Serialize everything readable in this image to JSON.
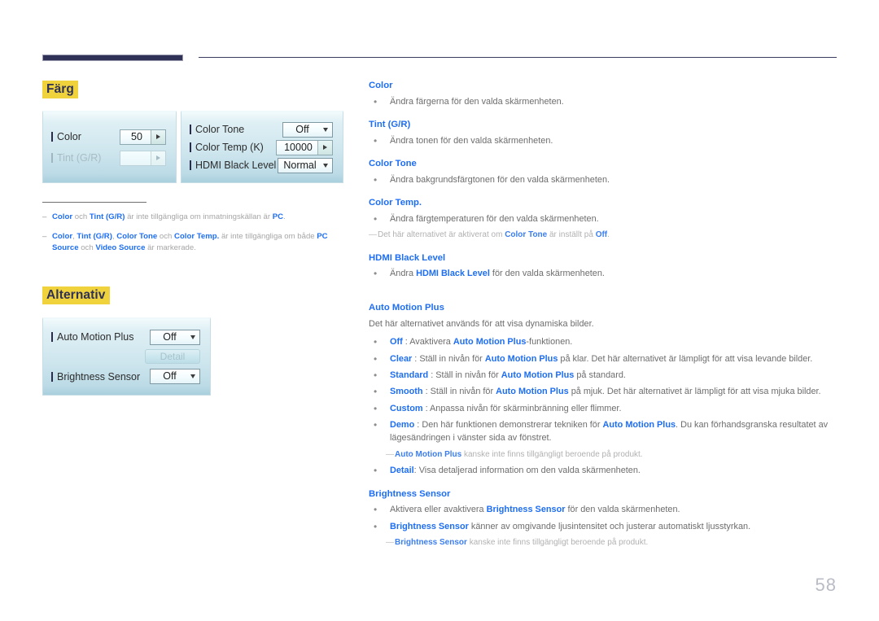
{
  "page": {
    "number": "58"
  },
  "sections": {
    "color": {
      "heading": "Färg",
      "osd": {
        "left_rows": [
          {
            "label": "Color",
            "value": "50",
            "control": "spinner",
            "disabled": false
          },
          {
            "label": "Tint (G/R)",
            "value": "",
            "control": "spinner",
            "disabled": true
          }
        ],
        "right_rows": [
          {
            "label": "Color Tone",
            "value": "Off",
            "control": "dropdown",
            "disabled": false
          },
          {
            "label": "Color Temp (K)",
            "value": "10000",
            "control": "spinner",
            "disabled": false
          },
          {
            "label": "HDMI Black Level",
            "value": "Normal",
            "control": "dropdown",
            "disabled": false
          }
        ]
      },
      "notes": [
        {
          "dash": "‒",
          "parts": [
            {
              "t": "Color",
              "b": true
            },
            {
              "t": " och ",
              "b": false
            },
            {
              "t": "Tint (G/R)",
              "b": true
            },
            {
              "t": " är inte tillgängliga om inmatningskällan är ",
              "b": false
            },
            {
              "t": "PC",
              "b": true
            },
            {
              "t": ".",
              "b": false
            }
          ]
        },
        {
          "dash": "‒",
          "parts": [
            {
              "t": "Color",
              "b": true
            },
            {
              "t": ", ",
              "b": false
            },
            {
              "t": "Tint (G/R)",
              "b": true
            },
            {
              "t": ", ",
              "b": false
            },
            {
              "t": "Color Tone",
              "b": true
            },
            {
              "t": " och ",
              "b": false
            },
            {
              "t": "Color Temp.",
              "b": true
            },
            {
              "t": " är inte tillgängliga om både ",
              "b": false
            },
            {
              "t": "PC Source",
              "b": true
            },
            {
              "t": " och ",
              "b": false
            },
            {
              "t": "Video Source",
              "b": true
            },
            {
              "t": " är markerade.",
              "b": false
            }
          ]
        }
      ]
    },
    "options": {
      "heading": "Alternativ",
      "osd": {
        "rows": [
          {
            "label": "Auto Motion Plus",
            "value": "Off",
            "control": "dropdown",
            "disabled": false
          },
          {
            "label": "Detail",
            "control": "button",
            "disabled": true
          },
          {
            "label": "Brightness Sensor",
            "value": "Off",
            "control": "dropdown",
            "disabled": false
          }
        ]
      }
    }
  },
  "descriptions": [
    {
      "type": "head",
      "text": "Color"
    },
    {
      "type": "bullet",
      "bullet": "•",
      "parts": [
        {
          "t": "Ändra färgerna för den valda skärmenheten.",
          "b": false
        }
      ]
    },
    {
      "type": "head",
      "text": "Tint (G/R)"
    },
    {
      "type": "bullet",
      "bullet": "•",
      "parts": [
        {
          "t": "Ändra tonen för den valda skärmenheten.",
          "b": false
        }
      ]
    },
    {
      "type": "head",
      "text": "Color Tone"
    },
    {
      "type": "bullet",
      "bullet": "•",
      "parts": [
        {
          "t": "Ändra bakgrundsfärgtonen för den valda skärmenheten.",
          "b": false
        }
      ]
    },
    {
      "type": "head",
      "text": "Color Temp."
    },
    {
      "type": "bullet",
      "bullet": "•",
      "parts": [
        {
          "t": "Ändra färgtemperaturen för den valda skärmenheten.",
          "b": false
        }
      ]
    },
    {
      "type": "note",
      "dash": "—",
      "indent": false,
      "parts": [
        {
          "t": "Det här alternativet är aktiverat om ",
          "b": false
        },
        {
          "t": "Color Tone",
          "b": true
        },
        {
          "t": " är inställt på ",
          "b": false
        },
        {
          "t": "Off",
          "b": true
        },
        {
          "t": ".",
          "b": false
        }
      ]
    },
    {
      "type": "head",
      "text": "HDMI Black Level"
    },
    {
      "type": "bullet",
      "bullet": "•",
      "parts": [
        {
          "t": "Ändra ",
          "b": false
        },
        {
          "t": "HDMI Black Level",
          "b": true
        },
        {
          "t": " för den valda skärmenheten.",
          "b": false
        }
      ]
    },
    {
      "type": "head",
      "text": "Auto Motion Plus",
      "gap": true
    },
    {
      "type": "para",
      "parts": [
        {
          "t": "Det här alternativet används för att visa dynamiska bilder.",
          "b": false
        }
      ]
    },
    {
      "type": "bullet",
      "bullet": "•",
      "parts": [
        {
          "t": "Off",
          "b": true
        },
        {
          "t": " : Avaktivera ",
          "b": false
        },
        {
          "t": "Auto Motion Plus",
          "b": true
        },
        {
          "t": "-funktionen.",
          "b": false
        }
      ]
    },
    {
      "type": "bullet",
      "bullet": "•",
      "parts": [
        {
          "t": "Clear",
          "b": true
        },
        {
          "t": " : Ställ in nivån för ",
          "b": false
        },
        {
          "t": "Auto Motion Plus",
          "b": true
        },
        {
          "t": " på klar. Det här alternativet är lämpligt för att visa levande bilder.",
          "b": false
        }
      ]
    },
    {
      "type": "bullet",
      "bullet": "•",
      "parts": [
        {
          "t": "Standard",
          "b": true
        },
        {
          "t": " : Ställ in nivån för ",
          "b": false
        },
        {
          "t": "Auto Motion Plus",
          "b": true
        },
        {
          "t": " på standard.",
          "b": false
        }
      ]
    },
    {
      "type": "bullet",
      "bullet": "•",
      "parts": [
        {
          "t": "Smooth",
          "b": true
        },
        {
          "t": " : Ställ in nivån för ",
          "b": false
        },
        {
          "t": "Auto Motion Plus",
          "b": true
        },
        {
          "t": " på mjuk. Det här alternativet är lämpligt för att visa mjuka bilder.",
          "b": false
        }
      ]
    },
    {
      "type": "bullet",
      "bullet": "•",
      "parts": [
        {
          "t": "Custom",
          "b": true
        },
        {
          "t": " : Anpassa nivån för skärminbränning eller flimmer.",
          "b": false
        }
      ]
    },
    {
      "type": "bullet",
      "bullet": "•",
      "parts": [
        {
          "t": "Demo",
          "b": true
        },
        {
          "t": " : Den här funktionen demonstrerar tekniken för ",
          "b": false
        },
        {
          "t": "Auto Motion Plus",
          "b": true
        },
        {
          "t": ". Du kan förhandsgranska resultatet av lägesändringen i vänster sida av fönstret.",
          "b": false
        }
      ]
    },
    {
      "type": "note",
      "dash": "—",
      "indent": true,
      "parts": [
        {
          "t": "Auto Motion Plus",
          "b": true
        },
        {
          "t": " kanske inte finns tillgängligt beroende på produkt.",
          "b": false
        }
      ]
    },
    {
      "type": "bullet",
      "bullet": "•",
      "parts": [
        {
          "t": "Detail",
          "b": true
        },
        {
          "t": ": Visa detaljerad information om den valda skärmenheten.",
          "b": false
        }
      ]
    },
    {
      "type": "head",
      "text": "Brightness Sensor"
    },
    {
      "type": "bullet",
      "bullet": "•",
      "parts": [
        {
          "t": "Aktivera eller avaktivera ",
          "b": false
        },
        {
          "t": "Brightness Sensor",
          "b": true
        },
        {
          "t": " för den valda skärmenheten.",
          "b": false
        }
      ]
    },
    {
      "type": "bullet",
      "bullet": "•",
      "parts": [
        {
          "t": "Brightness Sensor",
          "b": true
        },
        {
          "t": " känner av omgivande ljusintensitet och justerar automatiskt ljusstyrkan.",
          "b": false
        }
      ]
    },
    {
      "type": "note",
      "dash": "—",
      "indent": true,
      "parts": [
        {
          "t": "Brightness Sensor",
          "b": true
        },
        {
          "t": " kanske inte finns tillgängligt beroende på produkt.",
          "b": false
        }
      ]
    }
  ],
  "colors": {
    "accent_blue": "#1e6ef2",
    "highlight_yellow": "#efd23c",
    "navy": "#2f3157",
    "body_gray": "#6d6d6d",
    "note_gray": "#b1b1b1",
    "page_number_gray": "#b9bcc4"
  }
}
